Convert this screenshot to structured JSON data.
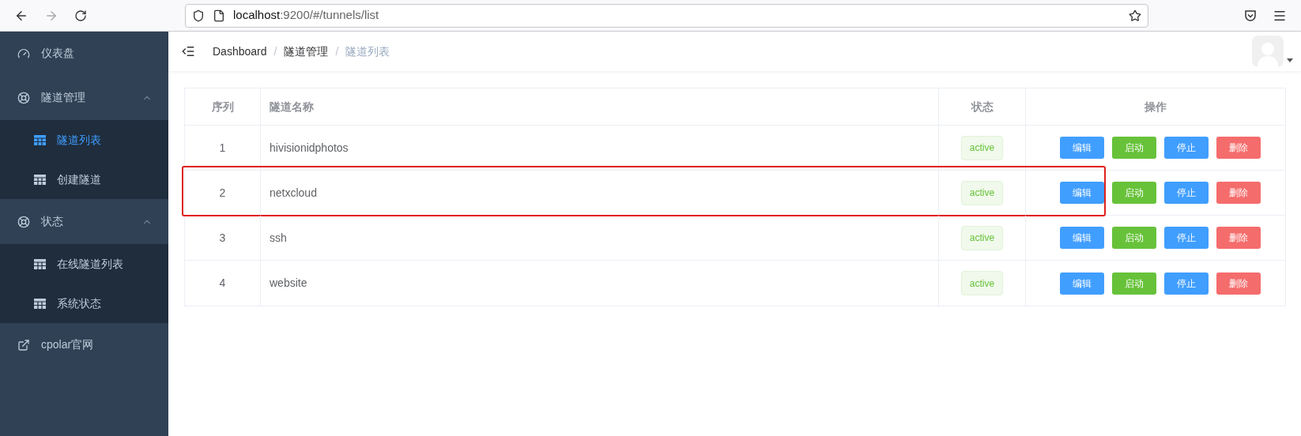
{
  "browser": {
    "back_enabled": true,
    "forward_enabled": false,
    "url_host": "localhost",
    "url_rest": ":9200/#/tunnels/list"
  },
  "sidebar": {
    "items": [
      {
        "kind": "dashboard",
        "label": "仪表盘",
        "selected": false
      },
      {
        "kind": "group",
        "label": "隧道管理",
        "expanded": true,
        "children": [
          {
            "label": "隧道列表",
            "selected": true
          },
          {
            "label": "创建隧道",
            "selected": false
          }
        ]
      },
      {
        "kind": "group",
        "label": "状态",
        "expanded": true,
        "children": [
          {
            "label": "在线隧道列表",
            "selected": false
          },
          {
            "label": "系统状态",
            "selected": false
          }
        ]
      },
      {
        "kind": "external_link",
        "label": "cpolar官网",
        "selected": false
      }
    ]
  },
  "breadcrumb": [
    {
      "label": "Dashboard",
      "current": false
    },
    {
      "separator": "/",
      "label": "隧道管理",
      "current": false
    },
    {
      "separator": "/",
      "label": "隧道列表",
      "current": true
    }
  ],
  "table": {
    "columns": [
      "序列",
      "隧道名称",
      "状态",
      "操作"
    ],
    "rows": [
      {
        "index": "1",
        "name": "hivisionidphotos",
        "status": "active",
        "highlighted": false,
        "actions": [
          {
            "kind": "edit",
            "label": "编辑"
          },
          {
            "kind": "start",
            "label": "启动"
          },
          {
            "kind": "stop",
            "label": "停止"
          },
          {
            "kind": "delete",
            "label": "删除"
          }
        ]
      },
      {
        "index": "2",
        "name": "netxcloud",
        "status": "active",
        "highlighted": true,
        "actions": [
          {
            "kind": "edit",
            "label": "编辑"
          },
          {
            "kind": "start",
            "label": "启动"
          },
          {
            "kind": "stop",
            "label": "停止"
          },
          {
            "kind": "delete",
            "label": "删除"
          }
        ]
      },
      {
        "index": "3",
        "name": "ssh",
        "status": "active",
        "highlighted": false,
        "actions": [
          {
            "kind": "edit",
            "label": "编辑"
          },
          {
            "kind": "start",
            "label": "启动"
          },
          {
            "kind": "stop",
            "label": "停止"
          },
          {
            "kind": "delete",
            "label": "删除"
          }
        ]
      },
      {
        "index": "4",
        "name": "website",
        "status": "active",
        "highlighted": false,
        "actions": [
          {
            "kind": "edit",
            "label": "编辑"
          },
          {
            "kind": "start",
            "label": "启动"
          },
          {
            "kind": "stop",
            "label": "停止"
          },
          {
            "kind": "delete",
            "label": "删除"
          }
        ]
      }
    ]
  }
}
